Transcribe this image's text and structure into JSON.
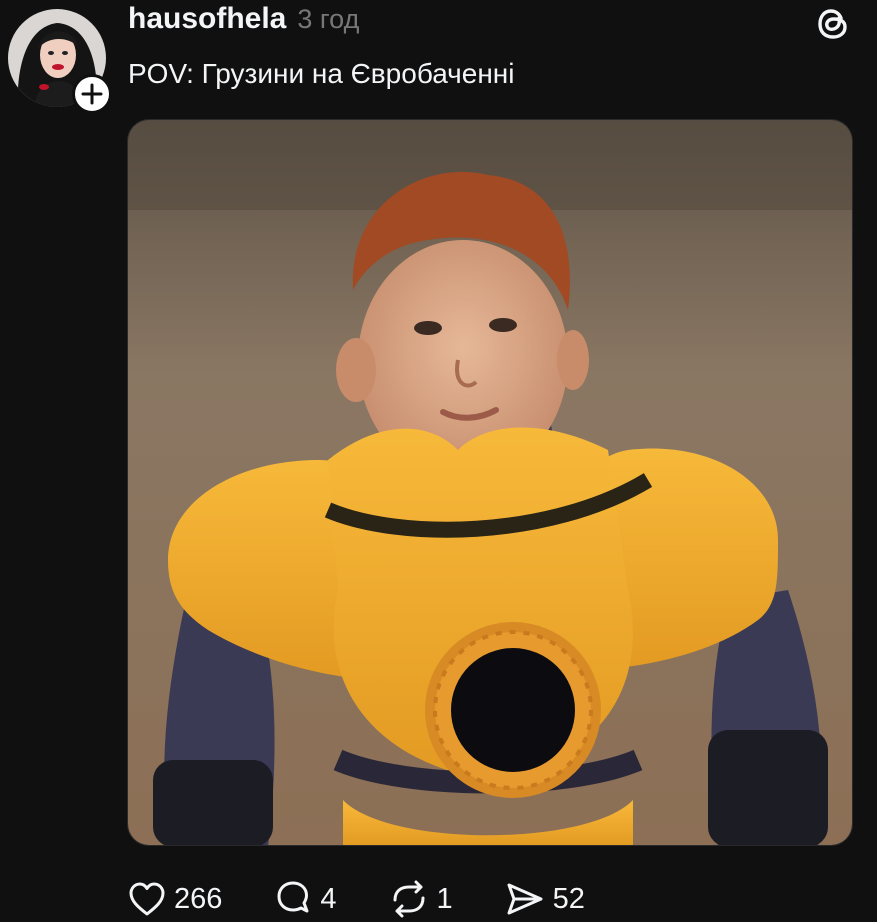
{
  "post": {
    "username": "hausofhela",
    "timestamp": "3 год",
    "caption": "POV: Грузини на Євробаченні",
    "media_icon": "photo-person-yellow-armor"
  },
  "actions": {
    "like": {
      "icon": "heart-icon",
      "count": "266"
    },
    "comment": {
      "icon": "comment-icon",
      "count": "4"
    },
    "repost": {
      "icon": "repost-icon",
      "count": "1"
    },
    "share": {
      "icon": "send-icon",
      "count": "52"
    }
  },
  "colors": {
    "background": "#101010",
    "text": "#f3f5f7",
    "secondary_text": "#777777",
    "armor_yellow": "#f2a82c"
  }
}
